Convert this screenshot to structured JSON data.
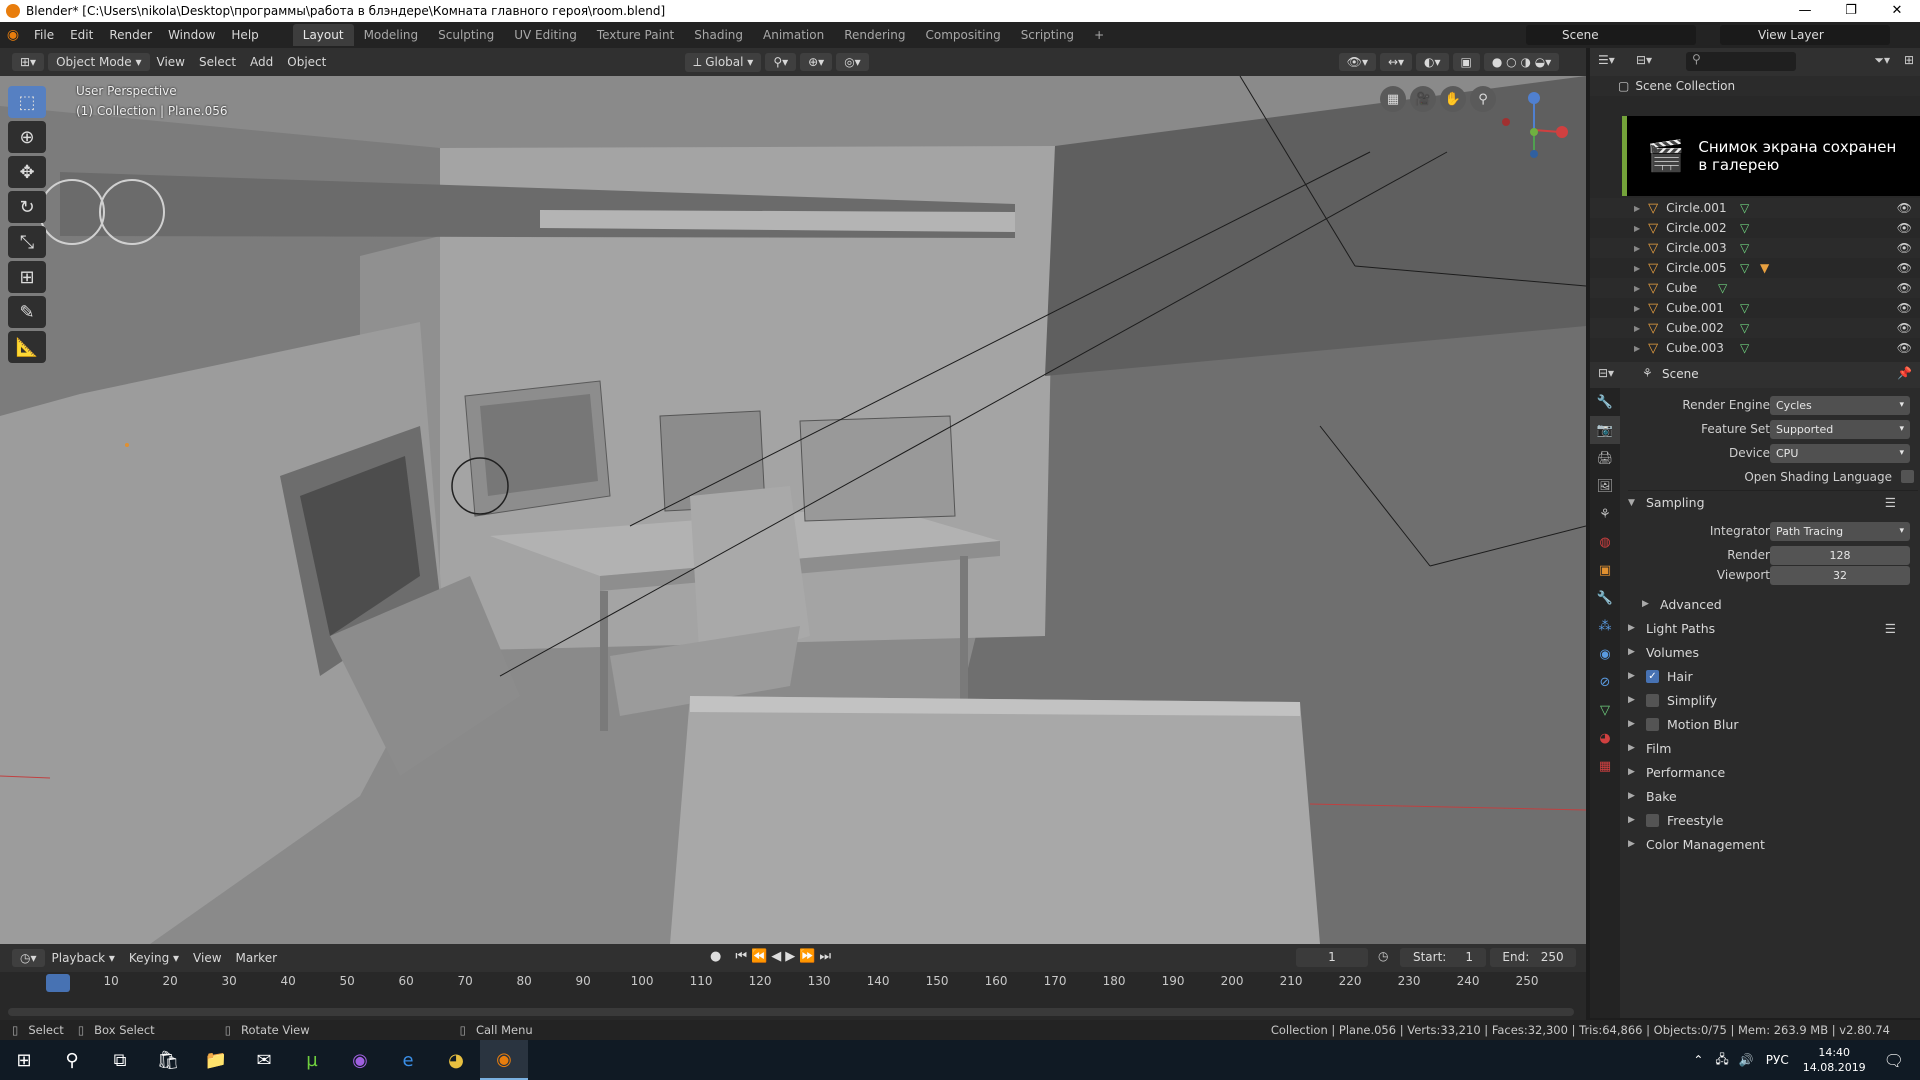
{
  "window": {
    "title": "Blender* [C:\\Users\\nikola\\Desktop\\программы\\работа в блэндере\\Комната главного героя\\room.blend]",
    "controls": [
      "—",
      "❐",
      "✕"
    ]
  },
  "menubar": {
    "items": [
      "File",
      "Edit",
      "Render",
      "Window",
      "Help"
    ],
    "workspaces": [
      "Layout",
      "Modeling",
      "Sculpting",
      "UV Editing",
      "Texture Paint",
      "Shading",
      "Animation",
      "Rendering",
      "Compositing",
      "Scripting"
    ],
    "add_workspace": "+",
    "scene_label": "Scene",
    "view_layer_label": "View Layer"
  },
  "viewport_header": {
    "mode": "Object Mode",
    "menus": [
      "View",
      "Select",
      "Add",
      "Object"
    ],
    "orientation": "Global"
  },
  "viewport": {
    "perspective": "User Perspective",
    "collection_info": "(1) Collection | Plane.056"
  },
  "outliner": {
    "root": "Scene Collection",
    "items": [
      {
        "name": "Circle.001",
        "extra": false
      },
      {
        "name": "Circle.002",
        "extra": false
      },
      {
        "name": "Circle.003",
        "extra": false
      },
      {
        "name": "Circle.005",
        "extra": true
      },
      {
        "name": "Cube",
        "extra": false
      },
      {
        "name": "Cube.001",
        "extra": false
      },
      {
        "name": "Cube.002",
        "extra": false
      },
      {
        "name": "Cube.003",
        "extra": false
      }
    ]
  },
  "toast": {
    "line1": "Снимок экрана сохранен",
    "line2": "в галерею"
  },
  "properties": {
    "context": "Scene",
    "render_engine_label": "Render Engine",
    "render_engine": "Cycles",
    "feature_set_label": "Feature Set",
    "feature_set": "Supported",
    "device_label": "Device",
    "device": "CPU",
    "osl_label": "Open Shading Language",
    "sampling": "Sampling",
    "integrator_label": "Integrator",
    "integrator": "Path Tracing",
    "render_label": "Render",
    "render_value": "128",
    "viewport_label": "Viewport",
    "viewport_value": "32",
    "advanced": "Advanced",
    "panels": [
      {
        "label": "Light Paths",
        "checkbox": null
      },
      {
        "label": "Volumes",
        "checkbox": null
      },
      {
        "label": "Hair",
        "checkbox": true
      },
      {
        "label": "Simplify",
        "checkbox": false
      },
      {
        "label": "Motion Blur",
        "checkbox": false
      },
      {
        "label": "Film",
        "checkbox": null
      },
      {
        "label": "Performance",
        "checkbox": null
      },
      {
        "label": "Bake",
        "checkbox": null
      },
      {
        "label": "Freestyle",
        "checkbox": false
      },
      {
        "label": "Color Management",
        "checkbox": null
      }
    ]
  },
  "timeline": {
    "menus": [
      "Playback",
      "Keying",
      "View",
      "Marker"
    ],
    "current_frame": "1",
    "start_label": "Start:",
    "start": "1",
    "end_label": "End:",
    "end": "250",
    "ticks": [
      "1",
      "10",
      "20",
      "30",
      "40",
      "50",
      "60",
      "70",
      "80",
      "90",
      "100",
      "110",
      "120",
      "130",
      "140",
      "150",
      "160",
      "170",
      "180",
      "190",
      "200",
      "210",
      "220",
      "230",
      "240",
      "250"
    ]
  },
  "statusbar": {
    "select": "Select",
    "box_select": "Box Select",
    "rotate_view": "Rotate View",
    "call_menu": "Call Menu",
    "stats": "Collection | Plane.056 | Verts:33,210 | Faces:32,300 | Tris:64,866 | Objects:0/75 | Mem: 263.9 MB | v2.80.74"
  },
  "taskbar": {
    "lang": "РУС",
    "time": "14:40",
    "date": "14.08.2019"
  }
}
